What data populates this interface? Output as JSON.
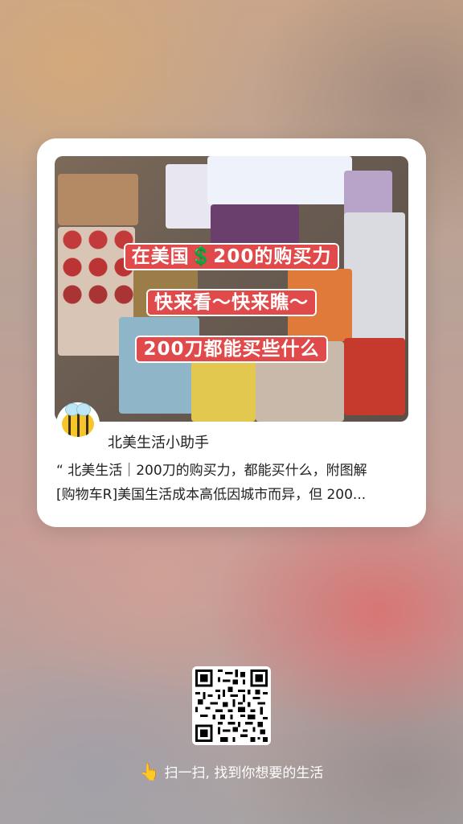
{
  "card": {
    "hero_overlay": {
      "line1": "在美国💲200的购买力",
      "line2": "快来看～快来瞧～",
      "line3": "200刀都能买些什么"
    },
    "author": "北美生活小助手",
    "description_line1": "“ 北美生活｜200刀的购买力，都能买什么，附图解",
    "description_line2": "[购物车R]美国生活成本高低因城市而异，但 200..."
  },
  "qr": {
    "icon": "qr-code-icon"
  },
  "footer": {
    "hand_icon": "pointing-hand-icon",
    "text": "扫一扫, 找到你想要的生活"
  }
}
